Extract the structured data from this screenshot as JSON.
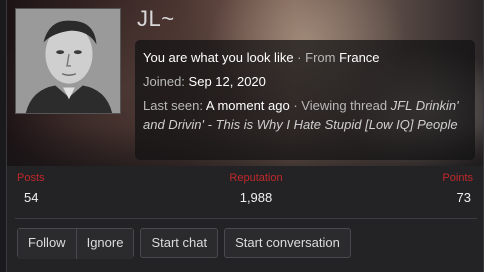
{
  "profile": {
    "username": "JL~",
    "about_prefix": "You are what you look like",
    "sep": " · ",
    "location_label": "From ",
    "location": "France",
    "joined_label": "Joined: ",
    "joined": "Sep 12, 2020",
    "lastseen_label": "Last seen: ",
    "lastseen": "A moment ago",
    "activity_label": "Viewing thread ",
    "thread_title": "JFL Drinkin' and Drivin' - This is Why I Hate Stupid [Low IQ] People"
  },
  "stats": {
    "posts_label": "Posts",
    "posts": "54",
    "reputation_label": "Reputation",
    "reputation": "1,988",
    "points_label": "Points",
    "points": "73"
  },
  "actions": {
    "follow": "Follow",
    "ignore": "Ignore",
    "start_chat": "Start chat",
    "start_conversation": "Start conversation"
  },
  "colors": {
    "stat_label": "#c0282a",
    "background": "#232326"
  }
}
